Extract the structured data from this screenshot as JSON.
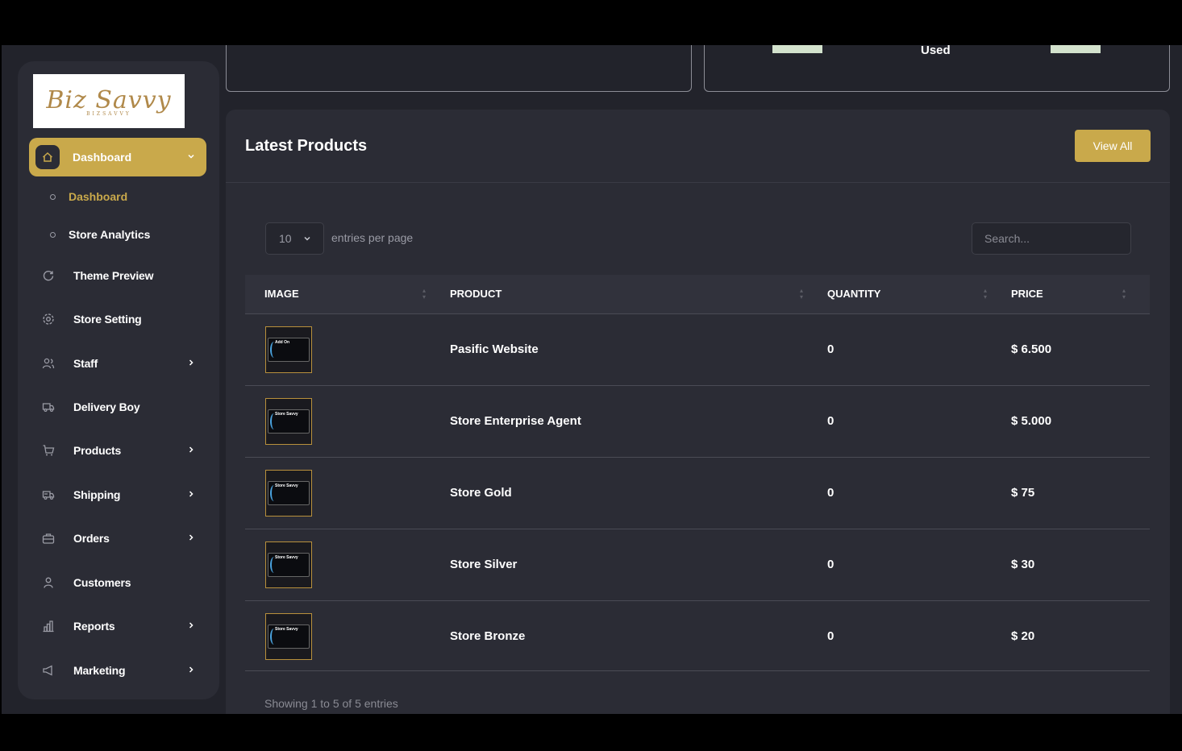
{
  "logo": {
    "script": "Biz Savvy",
    "sub": "BIZSAVVY"
  },
  "sidebar": {
    "active": {
      "label": "Dashboard",
      "icon": "home-icon"
    },
    "subitems": [
      {
        "label": "Dashboard",
        "active": true
      },
      {
        "label": "Store Analytics",
        "active": false
      }
    ],
    "items": [
      {
        "label": "Theme Preview",
        "icon": "refresh-icon",
        "chevron": false
      },
      {
        "label": "Store Setting",
        "icon": "gear-icon",
        "chevron": false
      },
      {
        "label": "Staff",
        "icon": "users-icon",
        "chevron": true
      },
      {
        "label": "Delivery Boy",
        "icon": "truck-icon",
        "chevron": false
      },
      {
        "label": "Products",
        "icon": "cart-icon",
        "chevron": true
      },
      {
        "label": "Shipping",
        "icon": "shipping-icon",
        "chevron": true
      },
      {
        "label": "Orders",
        "icon": "briefcase-icon",
        "chevron": true
      },
      {
        "label": "Customers",
        "icon": "user-icon",
        "chevron": false
      },
      {
        "label": "Reports",
        "icon": "chart-icon",
        "chevron": true
      },
      {
        "label": "Marketing",
        "icon": "megaphone-icon",
        "chevron": true
      }
    ]
  },
  "top_cards": {
    "used_label": "Used"
  },
  "products": {
    "title": "Latest Products",
    "view_all": "View All",
    "entries_value": "10",
    "entries_label": "entries per page",
    "search_placeholder": "Search...",
    "columns": [
      "IMAGE",
      "PRODUCT",
      "QUANTITY",
      "PRICE"
    ],
    "rows": [
      {
        "thumb": "Add On",
        "product": "Pasific Website",
        "quantity": "0",
        "price": "$ 6.500"
      },
      {
        "thumb": "Store Savvy",
        "product": "Store Enterprise Agent",
        "quantity": "0",
        "price": "$ 5.000"
      },
      {
        "thumb": "Store Savvy",
        "product": "Store Gold",
        "quantity": "0",
        "price": "$ 75"
      },
      {
        "thumb": "Store Savvy",
        "product": "Store Silver",
        "quantity": "0",
        "price": "$ 30"
      },
      {
        "thumb": "Store Savvy",
        "product": "Store Bronze",
        "quantity": "0",
        "price": "$ 20"
      }
    ],
    "footer": "Showing 1 to 5 of 5 entries"
  },
  "colors": {
    "accent": "#c9a94b",
    "panel": "#2b2c35",
    "background": "#22232b"
  }
}
